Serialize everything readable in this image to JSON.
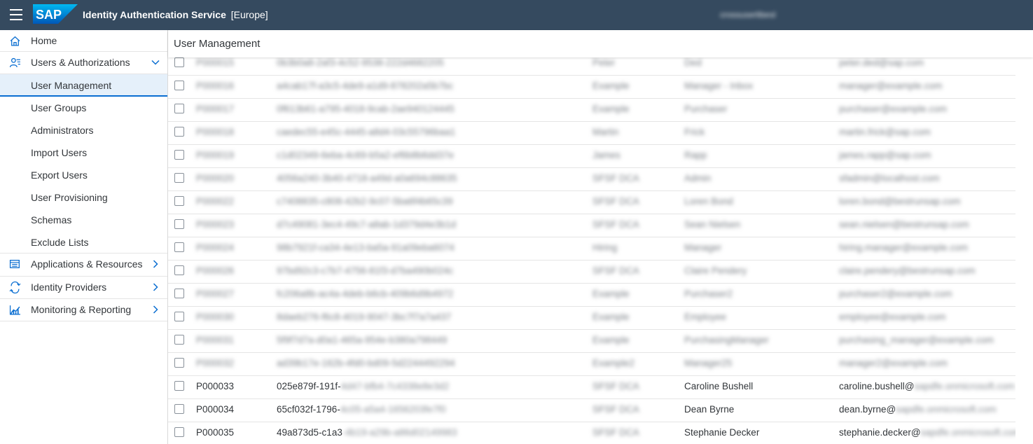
{
  "header": {
    "logo_text": "SAP",
    "app_title": "Identity Authentication Service",
    "region": "[Europe]",
    "user": "crossuserlibesl",
    "colors": {
      "shell": "#354a5f",
      "accent": "#0a6ed1",
      "selected_bg": "#e5f0fa"
    }
  },
  "sidebar": {
    "items": [
      {
        "label": "Home",
        "icon": "home-icon"
      },
      {
        "label": "Users & Authorizations",
        "icon": "users-icon",
        "expanded": true
      },
      {
        "label": "Applications & Resources",
        "icon": "applications-icon"
      },
      {
        "label": "Identity Providers",
        "icon": "identity-providers-icon"
      },
      {
        "label": "Monitoring & Reporting",
        "icon": "monitoring-icon"
      }
    ],
    "sub_items": [
      {
        "label": "User Management",
        "selected": true
      },
      {
        "label": "User Groups"
      },
      {
        "label": "Administrators"
      },
      {
        "label": "Import Users"
      },
      {
        "label": "Export Users"
      },
      {
        "label": "User Provisioning"
      },
      {
        "label": "Schemas"
      },
      {
        "label": "Exclude Lists"
      }
    ]
  },
  "main": {
    "title": "User Management",
    "rows": [
      {
        "id": "P000015",
        "uuid": "0b3b0a8-2af3-4c52-9538-222d4682205",
        "first": "Peter",
        "last": "Ded",
        "mail": "peter.ded@sap.com"
      },
      {
        "id": "P000016",
        "uuid": "a4cab17f-a3c5-4de9-a1d9-878202a5b7bc",
        "first": "Example",
        "last": "Manager - Inbox",
        "mail": "manager@example.com"
      },
      {
        "id": "P000017",
        "uuid": "0f613b61-a795-4018-9cab-2ae940124445",
        "first": "Example",
        "last": "Purchaser",
        "mail": "purchaser@example.com"
      },
      {
        "id": "P000018",
        "uuid": "caedec55-e45c-4445-a8d4-03c55796baa1",
        "first": "Martin",
        "last": "Frick",
        "mail": "martin.frick@sap.com"
      },
      {
        "id": "P000019",
        "uuid": "c1d02349-6eba-4c69-b5a2-ef6b8b6dd37e",
        "first": "James",
        "last": "Rapp",
        "mail": "james.rapp@sap.com"
      },
      {
        "id": "P000020",
        "uuid": "4056a240-3b40-4718-a49d-a0a694c88635",
        "first": "SFSF DCA",
        "last": "Admin",
        "mail": "sfadmin@localhost.com"
      },
      {
        "id": "P000022",
        "uuid": "c7408835-c808-42b2-9c07-5ba6f4b65c39",
        "first": "SFSF DCA",
        "last": "Loren Bond",
        "mail": "loren.bond@bestrunsap.com"
      },
      {
        "id": "P000023",
        "uuid": "d7c49081-3ec4-49c7-a8ab-1d379d4e3b1d",
        "first": "SFSF DCA",
        "last": "Sean Nielsen",
        "mail": "sean.nielsen@bestrunsap.com"
      },
      {
        "id": "P000024",
        "uuid": "98b7921f-ca34-4e13-ba5a-91a09eba6074",
        "first": "Hiring",
        "last": "Manager",
        "mail": "hiring.manager@example.com"
      },
      {
        "id": "P000026",
        "uuid": "97bd92c3-c7b7-4756-81f3-d7ba490b024c",
        "first": "SFSF DCA",
        "last": "Claire Pendery",
        "mail": "claire.pendery@bestrunsap.com"
      },
      {
        "id": "P000027",
        "uuid": "fc206a8b-ac4a-4deb-b6cb-409b6d9b4972",
        "first": "Example",
        "last": "Purchaser2",
        "mail": "purchaser2@example.com"
      },
      {
        "id": "P000030",
        "uuid": "8daeb276-f6c8-4019-9047-3bc7f7a7a437",
        "first": "Example",
        "last": "Employee",
        "mail": "employee@example.com"
      },
      {
        "id": "P000031",
        "uuid": "5f9f7d7a-d0a1-465a-954e-b380a798449",
        "first": "Example",
        "last": "PurchasingManager",
        "mail": "purchasing_manager@example.com"
      },
      {
        "id": "P000032",
        "uuid": "ad39b17e-162b-4fd0-bd09-5d2244492294",
        "first": "Example2",
        "last": "Manager25",
        "mail": "manager2@example.com"
      },
      {
        "id": "P000033",
        "uuid_visible": "025e879f-191f-",
        "uuid_hidden": "4d47-bfb4-7c4338e8e3d2",
        "first": "SFSF DCA",
        "last": "Caroline Bushell",
        "mail_visible": "caroline.bushell@",
        "mail_hidden": "sapdfe.onmicrosoft.com"
      },
      {
        "id": "P000034",
        "uuid_visible": "65cf032f-1796-",
        "uuid_hidden": "4c05-a5a4-1656203fe7f0",
        "first": "SFSF DCA",
        "last": "Dean Byrne",
        "mail_visible": "dean.byrne@",
        "mail_hidden": "sapdfe.onmicrosoft.com"
      },
      {
        "id": "P000035",
        "uuid_visible": "49a873d5-c1a3",
        "uuid_hidden": "-4b19-a29b-a86d02149983",
        "first": "SFSF DCA",
        "last": "Stephanie Decker",
        "mail_visible": "stephanie.decker@",
        "mail_hidden": "sapdfe.onmicrosoft.com"
      }
    ]
  }
}
